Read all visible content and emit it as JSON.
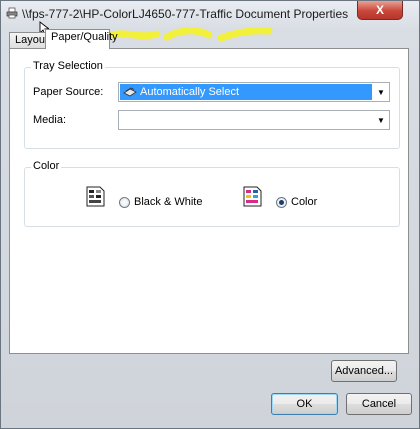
{
  "window": {
    "title": "\\\\fps-777-2\\HP-ColorLJ4650-777-Traffic Document Properties",
    "close_label": "X"
  },
  "tabs": [
    {
      "label": "Layout",
      "active": false
    },
    {
      "label": "Paper/Quality",
      "active": true
    }
  ],
  "tray_selection": {
    "group_label": "Tray Selection",
    "paper_source_label": "Paper Source:",
    "paper_source_value": "Automatically Select",
    "media_label": "Media:",
    "media_value": ""
  },
  "color": {
    "group_label": "Color",
    "options": [
      {
        "label": "Black & White",
        "selected": false
      },
      {
        "label": "Color",
        "selected": true
      }
    ]
  },
  "buttons": {
    "advanced": "Advanced...",
    "ok": "OK",
    "cancel": "Cancel"
  },
  "colors": {
    "selection": "#3399ff",
    "highlight_marks": "#f2f03a"
  }
}
